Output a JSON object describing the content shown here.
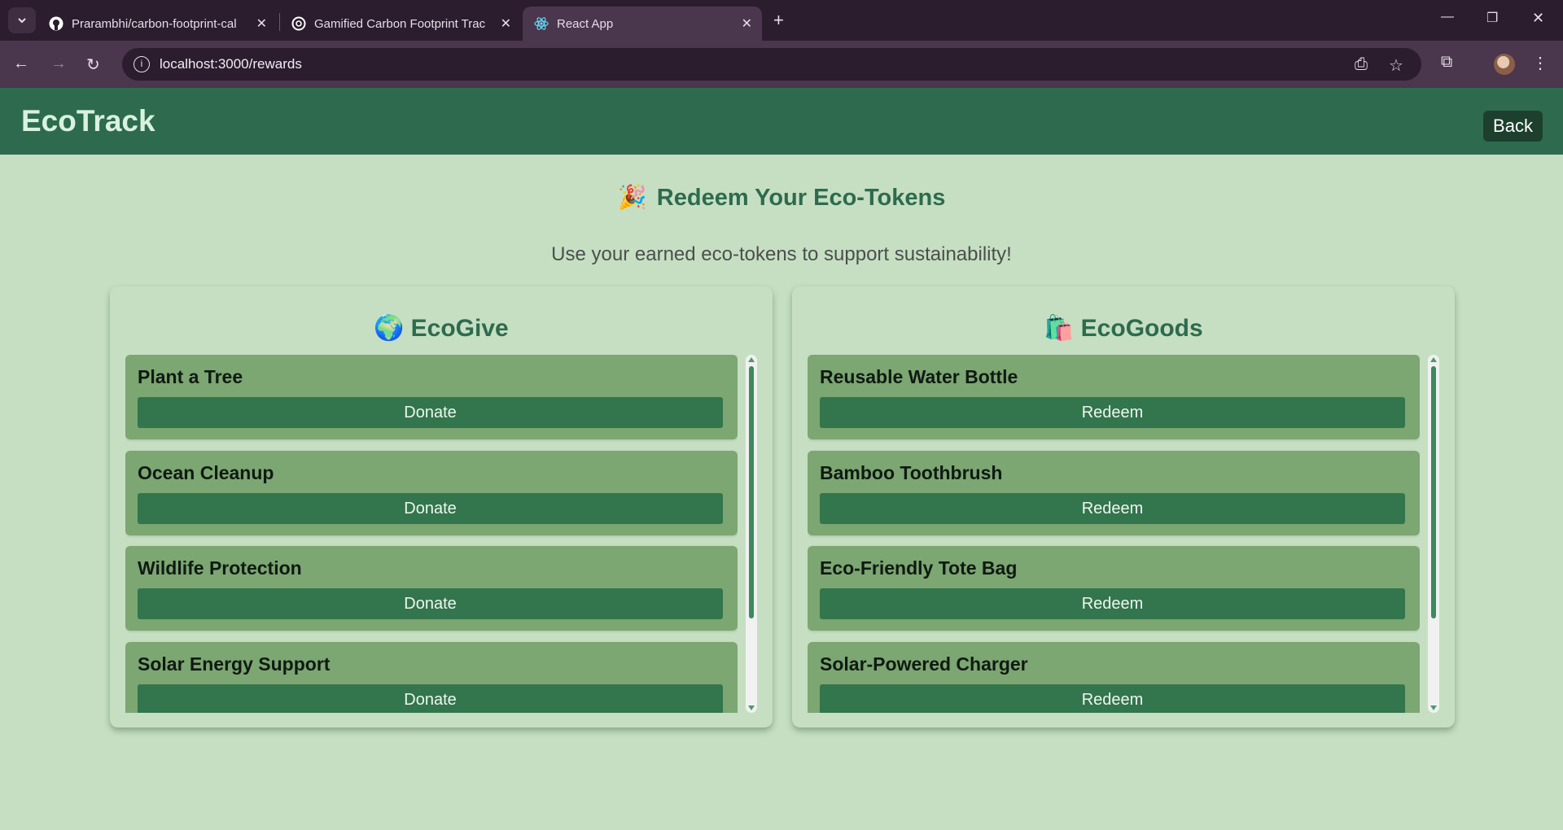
{
  "browser": {
    "tabs": [
      {
        "title": "Prarambhi/carbon-footprint-cal",
        "icon": "github-icon"
      },
      {
        "title": "Gamified Carbon Footprint Trac",
        "icon": "openai-icon"
      },
      {
        "title": "React App",
        "icon": "react-icon",
        "active": true
      }
    ],
    "url": "localhost:3000/rewards"
  },
  "header": {
    "brand": "EcoTrack",
    "back_label": "Back",
    "color": "#2e6b4e"
  },
  "main": {
    "title_emoji": "🎉",
    "title": "Redeem Your Eco-Tokens",
    "subtitle": "Use your earned eco-tokens to support sustainability!"
  },
  "ecogive": {
    "emoji": "🌍",
    "heading": "EcoGive",
    "items": [
      {
        "name": "Plant a Tree",
        "action": "Donate"
      },
      {
        "name": "Ocean Cleanup",
        "action": "Donate"
      },
      {
        "name": "Wildlife Protection",
        "action": "Donate"
      },
      {
        "name": "Solar Energy Support",
        "action": "Donate"
      }
    ]
  },
  "ecogoods": {
    "emoji": "🛍️",
    "heading": "EcoGoods",
    "items": [
      {
        "name": "Reusable Water Bottle",
        "action": "Redeem"
      },
      {
        "name": "Bamboo Toothbrush",
        "action": "Redeem"
      },
      {
        "name": "Eco-Friendly Tote Bag",
        "action": "Redeem"
      },
      {
        "name": "Solar-Powered Charger",
        "action": "Redeem"
      }
    ]
  },
  "colors": {
    "page_bg": "#c6dfc2",
    "card_bg": "#7ca672",
    "button_bg": "#33754c"
  }
}
